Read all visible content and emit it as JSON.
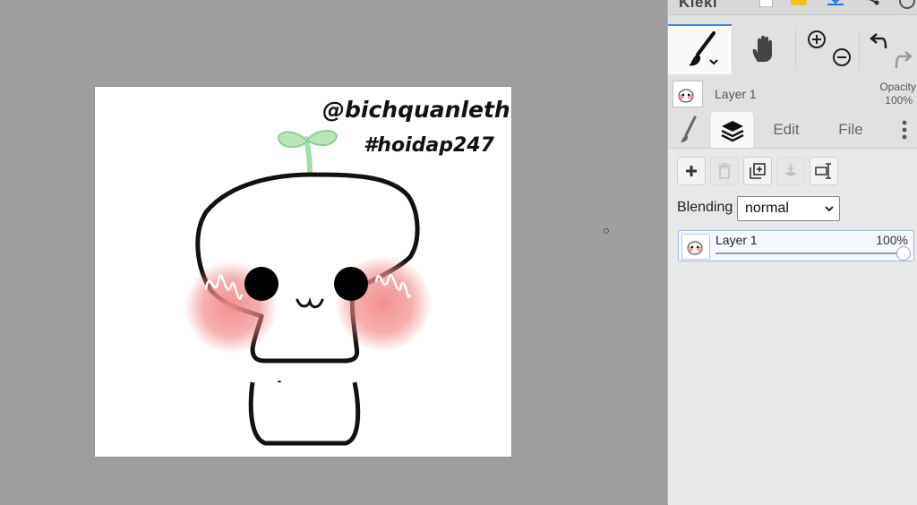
{
  "app": {
    "name": "Kleki"
  },
  "canvas": {
    "watermark_handle": "@bichquanlethi",
    "watermark_hashtag": "#hoidap247"
  },
  "panel": {
    "layer_preview": {
      "name": "Layer 1",
      "opacity_label": "Opacity",
      "opacity_value": "100%"
    },
    "tabs": {
      "edit": "Edit",
      "file": "File"
    },
    "blending": {
      "label": "Blending",
      "value": "normal"
    },
    "layers": [
      {
        "name": "Layer 1",
        "opacity": "100%",
        "opacity_fraction": 1.0
      }
    ]
  },
  "colors": {
    "accent": "#3d8ae5",
    "workspace": "#9e9e9e",
    "panel": "#e1e1e1",
    "blush": "#f28b8b",
    "sprout": "#a6dcaa"
  },
  "icons": {
    "toolbar": [
      "brush-icon",
      "hand-icon",
      "zoom-in-icon",
      "zoom-out-icon",
      "undo-icon",
      "redo-icon"
    ],
    "layer_actions": [
      "add-icon",
      "trash-icon",
      "duplicate-icon",
      "merge-down-icon",
      "rename-icon"
    ]
  }
}
